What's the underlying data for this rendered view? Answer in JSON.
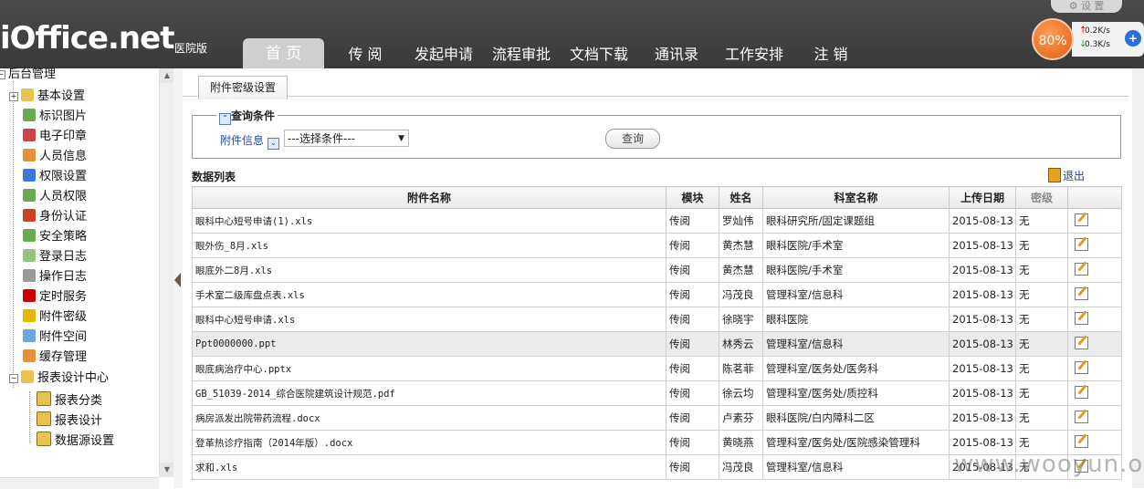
{
  "header": {
    "logo": "iOffice.net",
    "logo_sub": "医院版",
    "settings_label": "设 置",
    "nav": [
      {
        "label": "首 页",
        "active": true
      },
      {
        "label": "传 阅",
        "active": false
      },
      {
        "label": "发起申请",
        "active": false
      },
      {
        "label": "流程审批",
        "active": false
      },
      {
        "label": "文档下载",
        "active": false
      },
      {
        "label": "通讯录",
        "active": false
      },
      {
        "label": "工作安排",
        "active": false
      },
      {
        "label": "注 销",
        "active": false
      }
    ],
    "net_widget": {
      "percent": "80%",
      "up": "0.2K/s",
      "down": "0.3K/s",
      "plus": "+"
    }
  },
  "sidebar": {
    "root": "后台管理",
    "items": [
      {
        "label": "基本设置",
        "icon": "folder-icon",
        "color": "#e8c350"
      },
      {
        "label": "标识图片",
        "icon": "image-icon",
        "color": "#6aa84f"
      },
      {
        "label": "电子印章",
        "icon": "stamp-icon",
        "color": "#cc4444"
      },
      {
        "label": "人员信息",
        "icon": "user-icon",
        "color": "#e69138"
      },
      {
        "label": "权限设置",
        "icon": "key-icon",
        "color": "#3c78d8"
      },
      {
        "label": "人员权限",
        "icon": "user-lock-icon",
        "color": "#6aa84f"
      },
      {
        "label": "身份认证",
        "icon": "id-icon",
        "color": "#cc4125"
      },
      {
        "label": "安全策略",
        "icon": "shield-icon",
        "color": "#6aa84f"
      },
      {
        "label": "登录日志",
        "icon": "log-icon",
        "color": "#93c47d"
      },
      {
        "label": "操作日志",
        "icon": "list-icon",
        "color": "#999999"
      },
      {
        "label": "定时服务",
        "icon": "clock-icon",
        "color": "#cc0000"
      },
      {
        "label": "附件密级",
        "icon": "attachment-icon",
        "color": "#e6b800"
      },
      {
        "label": "附件空间",
        "icon": "disk-icon",
        "color": "#6fa8dc"
      },
      {
        "label": "缓存管理",
        "icon": "cache-icon",
        "color": "#e69138"
      },
      {
        "label": "报表设计中心",
        "icon": "folder-open-icon",
        "color": "#e8c350"
      },
      {
        "label": "报表分类",
        "icon": "report-icon",
        "color": "#e8c350"
      },
      {
        "label": "报表设计",
        "icon": "report-icon",
        "color": "#e8c350"
      },
      {
        "label": "数据源设置",
        "icon": "report-icon",
        "color": "#e8c350"
      }
    ]
  },
  "main": {
    "tab": "附件密级设置",
    "query": {
      "legend": "查询条件",
      "label": "附件信息",
      "select_value": "---选择条件---",
      "button": "查询"
    },
    "list_title": "数据列表",
    "exit": "退出",
    "columns": [
      "附件名称",
      "模块",
      "姓名",
      "科室名称",
      "上传日期",
      "密级",
      ""
    ],
    "rows": [
      {
        "name": "眼科中心短号申请(1).xls",
        "module": "传阅",
        "person": "罗灿伟",
        "dept": "眼科研究所/固定课题组",
        "date": "2015-08-13",
        "level": "无"
      },
      {
        "name": "眼外伤_8月.xls",
        "module": "传阅",
        "person": "黄杰慧",
        "dept": "眼科医院/手术室",
        "date": "2015-08-13",
        "level": "无"
      },
      {
        "name": "眼底外二8月.xls",
        "module": "传阅",
        "person": "黄杰慧",
        "dept": "眼科医院/手术室",
        "date": "2015-08-13",
        "level": "无"
      },
      {
        "name": "手术室二级库盘点表.xls",
        "module": "传阅",
        "person": "冯茂良",
        "dept": "管理科室/信息科",
        "date": "2015-08-13",
        "level": "无"
      },
      {
        "name": "眼科中心短号申请.xls",
        "module": "传阅",
        "person": "徐晓宇",
        "dept": "眼科医院",
        "date": "2015-08-13",
        "level": "无"
      },
      {
        "name": "Ppt0000000.ppt",
        "module": "传阅",
        "person": "林秀云",
        "dept": "管理科室/信息科",
        "date": "2015-08-13",
        "level": "无"
      },
      {
        "name": "眼底病治疗中心.pptx",
        "module": "传阅",
        "person": "陈茗菲",
        "dept": "管理科室/医务处/医务科",
        "date": "2015-08-13",
        "level": "无"
      },
      {
        "name": "GB_51039-2014_综合医院建筑设计规范.pdf",
        "module": "传阅",
        "person": "徐云均",
        "dept": "管理科室/医务处/质控科",
        "date": "2015-08-13",
        "level": "无"
      },
      {
        "name": "病房派发出院带药流程.docx",
        "module": "传阅",
        "person": "卢素芬",
        "dept": "眼科医院/白内障科二区",
        "date": "2015-08-13",
        "level": "无"
      },
      {
        "name": "登革热诊疗指南（2014年版）.docx",
        "module": "传阅",
        "person": "黄晓燕",
        "dept": "管理科室/医务处/医院感染管理科",
        "date": "2015-08-13",
        "level": "无"
      },
      {
        "name": "求和.xls",
        "module": "传阅",
        "person": "冯茂良",
        "dept": "管理科室/信息科",
        "date": "2015-08-13",
        "level": "无"
      }
    ]
  },
  "watermark": "www.wooyun.org"
}
